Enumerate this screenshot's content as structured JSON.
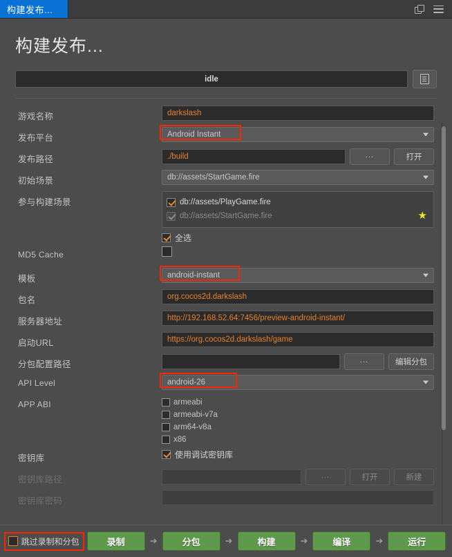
{
  "window": {
    "tab_label": "构建发布...",
    "restore_icon": "restore-window-icon",
    "menu_icon": "hamburger-menu-icon"
  },
  "page": {
    "title": "构建发布...",
    "status_text": "idle",
    "log_button_icon": "log-document-icon"
  },
  "form": {
    "game_name": {
      "label": "游戏名称",
      "value": "darkslash"
    },
    "platform": {
      "label": "发布平台",
      "value": "Android Instant",
      "highlighted": true
    },
    "build_path": {
      "label": "发布路径",
      "value": "./build",
      "browse_label": "...",
      "open_label": "打开"
    },
    "start_scene": {
      "label": "初始场景",
      "value": "db://assets/StartGame.fire"
    },
    "scenes": {
      "label": "参与构建场景",
      "items": [
        {
          "name": "db://assets/PlayGame.fire",
          "checked": true,
          "disabled": false,
          "starred": false
        },
        {
          "name": "db://assets/StartGame.fire",
          "checked": true,
          "disabled": true,
          "starred": true
        }
      ],
      "select_all_label": "全选",
      "select_all_checked": true
    },
    "md5_cache": {
      "label": "MD5 Cache",
      "checked": false
    },
    "template": {
      "label": "模板",
      "value": "android-instant",
      "highlighted": true
    },
    "package_name": {
      "label": "包名",
      "value": "org.cocos2d.darkslash"
    },
    "server_url": {
      "label": "服务器地址",
      "value": "http://192.168.52.64:7456/preview-android-instant/"
    },
    "start_url": {
      "label": "启动URL",
      "value": "https://org.cocos2d.darkslash/game"
    },
    "subpackage_config": {
      "label": "分包配置路径",
      "value": "",
      "browse_label": "...",
      "edit_label": "编辑分包"
    },
    "api_level": {
      "label": "API Level",
      "value": "android-26",
      "highlighted": true
    },
    "app_abi": {
      "label": "APP ABI",
      "items": [
        {
          "name": "armeabi",
          "checked": false
        },
        {
          "name": "armeabi-v7a",
          "checked": false
        },
        {
          "name": "arm64-v8a",
          "checked": false
        },
        {
          "name": "x86",
          "checked": false
        }
      ]
    },
    "keystore": {
      "label": "密钥库",
      "use_debug_label": "使用调试密钥库",
      "use_debug_checked": true
    },
    "keystore_path": {
      "label": "密钥库路径",
      "value": "",
      "browse_label": "...",
      "open_label": "打开",
      "new_label": "新建",
      "disabled": true
    },
    "keystore_password": {
      "label": "密钥库密码",
      "value": "",
      "disabled": true
    }
  },
  "bottom": {
    "skip_label": "跳过录制和分包",
    "skip_checked": false,
    "skip_highlighted": true,
    "arrow": "➜",
    "buttons": [
      {
        "label": "录制"
      },
      {
        "label": "分包"
      },
      {
        "label": "构建"
      },
      {
        "label": "编译"
      },
      {
        "label": "运行"
      }
    ]
  },
  "colors": {
    "accent_orange": "#e8822a",
    "highlight_red": "#fa2600",
    "action_green": "#5f9a4c",
    "tab_blue": "#0a72d6",
    "star_yellow": "#f2e52b"
  }
}
